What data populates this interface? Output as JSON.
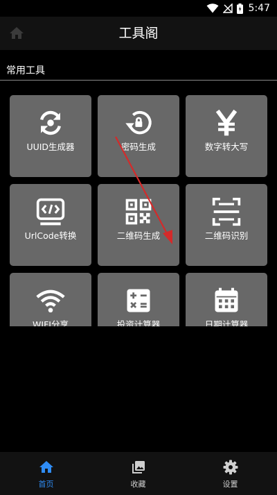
{
  "status_bar": {
    "time": "5:47"
  },
  "app_bar": {
    "title": "工具阁"
  },
  "section": {
    "title": "常用工具"
  },
  "tools": [
    {
      "label": "UUID生成器",
      "icon": "refresh-icon"
    },
    {
      "label": "密码生成",
      "icon": "lock-reset-icon"
    },
    {
      "label": "数字转大写",
      "icon": "yen-icon"
    },
    {
      "label": "UrlCode转换",
      "icon": "code-window-icon"
    },
    {
      "label": "二维码生成",
      "icon": "qr-code-icon"
    },
    {
      "label": "二维码识别",
      "icon": "scan-icon"
    },
    {
      "label": "WIFI分享",
      "icon": "wifi-icon"
    },
    {
      "label": "投资计算器",
      "icon": "calculator-icon"
    },
    {
      "label": "日期计算器",
      "icon": "calendar-icon"
    }
  ],
  "bottom_nav": [
    {
      "label": "首页",
      "icon": "home-icon",
      "active": true
    },
    {
      "label": "收藏",
      "icon": "image-icon",
      "active": false
    },
    {
      "label": "设置",
      "icon": "gear-icon",
      "active": false
    }
  ],
  "colors": {
    "accent": "#2f8cf4",
    "background": "#000000",
    "tile": "#686868",
    "nav_inactive": "#cfcfcf",
    "annotation_arrow": "#d42a2a"
  }
}
